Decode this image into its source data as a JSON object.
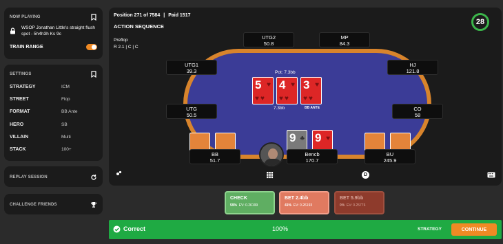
{
  "now_playing": {
    "heading": "NOW PLAYING",
    "title": "WSOP Jonathan Little's straight flush spot - 5h4h3h Ks 9c",
    "train_range_label": "TRAIN RANGE",
    "train_range_on": true
  },
  "settings": {
    "heading": "SETTINGS",
    "rows": [
      {
        "key": "STRATEGY",
        "value": "ICM"
      },
      {
        "key": "STREET",
        "value": "Flop"
      },
      {
        "key": "FORMAT",
        "value": "BB Ante"
      },
      {
        "key": "HERO",
        "value": "SB"
      },
      {
        "key": "VILLAIN",
        "value": "Multi"
      },
      {
        "key": "STACK",
        "value": "100+"
      }
    ]
  },
  "replay": {
    "label": "REPLAY SESSION"
  },
  "challenge": {
    "label": "CHALLENGE FRIENDS"
  },
  "header": {
    "position_text": "Position 271 of 7584",
    "paid_text": "Paid 1517",
    "action_sequence": "ACTION SEQUENCE",
    "street": "Preflop",
    "actions": "R 2.1  |  C  |  C",
    "timer": "28"
  },
  "seats": [
    {
      "name": "UTG2",
      "stack": "50.8"
    },
    {
      "name": "MP",
      "stack": "84.3"
    },
    {
      "name": "UTG1",
      "stack": "39.3"
    },
    {
      "name": "HJ",
      "stack": "121.8"
    },
    {
      "name": "UTG",
      "stack": "50.5"
    },
    {
      "name": "CO",
      "stack": "58"
    },
    {
      "name": "BB",
      "stack": "51.7"
    },
    {
      "name": "Bencb",
      "stack": "170.7"
    },
    {
      "name": "BU",
      "stack": "245.9"
    }
  ],
  "pot": {
    "label": "Pot: 7.3bb",
    "center_bet": "7.3bb",
    "ante": "BB ANTE"
  },
  "board": [
    {
      "rank": "5",
      "suit": "♥"
    },
    {
      "rank": "4",
      "suit": "♥"
    },
    {
      "rank": "3",
      "suit": "♥"
    }
  ],
  "hero_cards": [
    {
      "rank": "9",
      "suit": "♣"
    },
    {
      "rank": "9",
      "suit": "♥"
    }
  ],
  "actions": [
    {
      "label": "CHECK",
      "pct": "59%",
      "ev": "EV: 0.26199",
      "color": "#5fae62"
    },
    {
      "label": "BET 2.4bb",
      "pct": "41%",
      "ev": "EV: 0.26193",
      "color": "#e07a60"
    },
    {
      "label": "BET 5.9bb",
      "pct": "0%",
      "ev": "EV: 0.25776",
      "color": "#8e3b2c"
    }
  ],
  "result": {
    "correct_label": "Correct",
    "percent": "100%",
    "strategy_label": "STRATEGY",
    "continue_label": "CONTINUE"
  },
  "dealer_button": "D",
  "icons": [
    "bookmark-icon",
    "lock-icon",
    "refresh-icon",
    "trophy-icon",
    "grid-icon",
    "chips-icon",
    "keyboard-icon",
    "check-circle-icon"
  ]
}
